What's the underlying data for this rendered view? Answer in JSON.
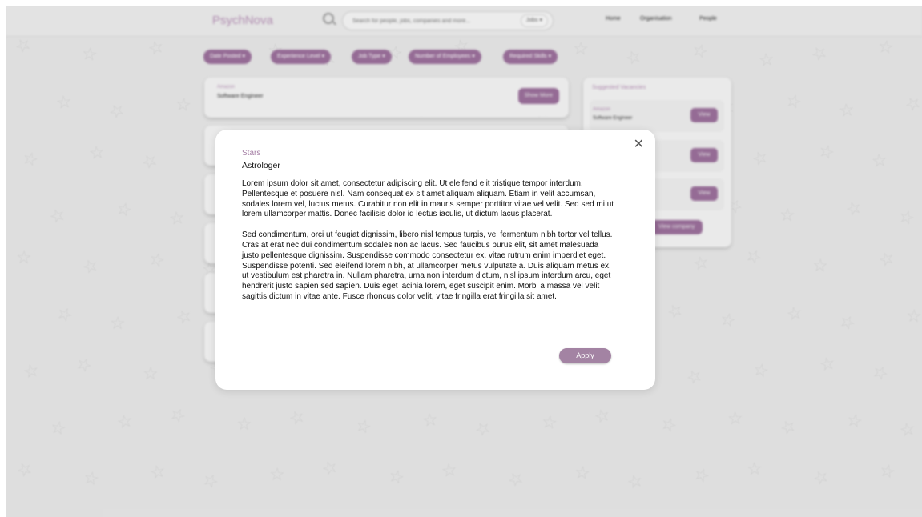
{
  "app": {
    "logo": "PsychNova"
  },
  "search": {
    "placeholder": "Search for people, jobs, companies and more...",
    "category": "Jobs ▾"
  },
  "nav": [
    "Home",
    "Organisation",
    "People"
  ],
  "filters": [
    "Date Posted ▾",
    "Experience Level ▾",
    "Job Type ▾",
    "Number of Employees ▾",
    "Required Skills ▾"
  ],
  "jobs": [
    {
      "company": "Amazon",
      "role": "Software Engineer",
      "button": "Show More"
    }
  ],
  "suggested": {
    "title": "Suggested Vacancies",
    "items": [
      {
        "company": "Amazon",
        "role": "Software Engineer",
        "button": "View"
      },
      {
        "company": "",
        "role": "",
        "button": "View"
      },
      {
        "company": "",
        "role": "",
        "button": "View"
      }
    ],
    "more_button": "View company"
  },
  "modal": {
    "company": "Stars",
    "role": "Astrologer",
    "paragraphs": [
      "Lorem ipsum dolor sit amet, consectetur adipiscing elit. Ut eleifend elit tristique tempor interdum. Pellentesque et posuere nisl. Nam consequat ex sit amet aliquam aliquam. Etiam in velit accumsan, sodales lorem vel, luctus metus. Curabitur non elit in mauris semper porttitor vitae vel velit. Sed sed mi ut lorem ullamcorper mattis. Donec facilisis dolor id lectus iaculis, ut dictum lacus placerat.",
      "Sed condimentum, orci ut feugiat dignissim, libero nisl tempus turpis, vel fermentum nibh tortor vel tellus. Cras at erat nec dui condimentum sodales non ac lacus. Sed faucibus purus elit, sit amet malesuada justo pellentesque dignissim. Suspendisse commodo consectetur ex, vitae rutrum enim imperdiet eget. Suspendisse potenti. Sed eleifend lorem nibh, at ullamcorper metus vulputate a. Duis aliquam metus ex, ut vestibulum est pharetra in. Nullam pharetra, urna non interdum dictum, nisl ipsum interdum arcu, eget hendrerit justo sapien sed sapien. Duis eget lacinia lorem, eget suscipit enim. Morbi a massa vel velit sagittis dictum in vitae ante. Fusce rhoncus dolor velit, vitae fringilla erat fringilla sit amet."
    ],
    "close_icon": "close-icon",
    "apply_label": "Apply"
  },
  "colors": {
    "accent": "#9a6f9a",
    "accent_light": "#a383a3",
    "background": "#e6e6e6"
  }
}
